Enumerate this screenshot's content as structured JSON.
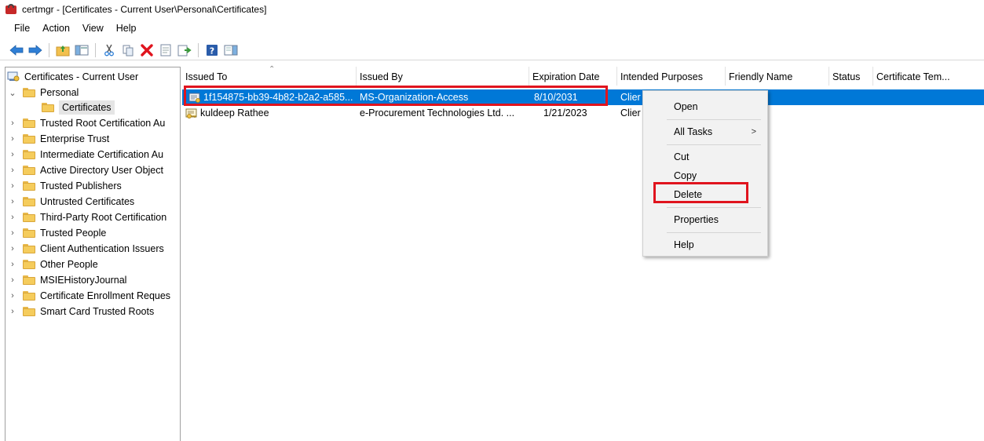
{
  "window": {
    "title": "certmgr - [Certificates - Current User\\Personal\\Certificates]"
  },
  "menu": [
    "File",
    "Action",
    "View",
    "Help"
  ],
  "toolbar": {
    "buttons": [
      "back-icon",
      "forward-icon",
      "up-folder-icon",
      "show-hide-tree-icon",
      "cut-icon",
      "copy-icon",
      "delete-icon",
      "properties-icon",
      "export-icon",
      "help-icon",
      "action-pane-icon"
    ]
  },
  "tree": {
    "root": "Certificates - Current User",
    "items": [
      "Personal",
      "Certificates",
      "Trusted Root Certification Au",
      "Enterprise Trust",
      "Intermediate Certification Au",
      "Active Directory User Object",
      "Trusted Publishers",
      "Untrusted Certificates",
      "Third-Party Root Certification",
      "Trusted People",
      "Client Authentication Issuers",
      "Other People",
      "MSIEHistoryJournal",
      "Certificate Enrollment Reques",
      "Smart Card Trusted Roots"
    ]
  },
  "list": {
    "columns": [
      "Issued To",
      "Issued By",
      "Expiration Date",
      "Intended Purposes",
      "Friendly Name",
      "Status",
      "Certificate Tem..."
    ],
    "rows": [
      {
        "issued_to": "1f154875-bb39-4b82-b2a2-a585...",
        "issued_by": "MS-Organization-Access",
        "expiration": "8/10/2031",
        "purposes": "Clier",
        "friendly": "",
        "status": "",
        "template": ""
      },
      {
        "issued_to": "kuldeep Rathee",
        "issued_by": "e-Procurement Technologies Ltd. ...",
        "expiration": "1/21/2023",
        "purposes": "Clier",
        "friendly": "",
        "status": "",
        "template": ""
      }
    ]
  },
  "context_menu": {
    "open": "Open",
    "all_tasks": "All Tasks",
    "submenu_arrow": ">",
    "cut": "Cut",
    "copy": "Copy",
    "delete": "Delete",
    "properties": "Properties",
    "help": "Help"
  },
  "colors": {
    "selection": "#0078d7",
    "highlight_box": "#e0141e"
  }
}
